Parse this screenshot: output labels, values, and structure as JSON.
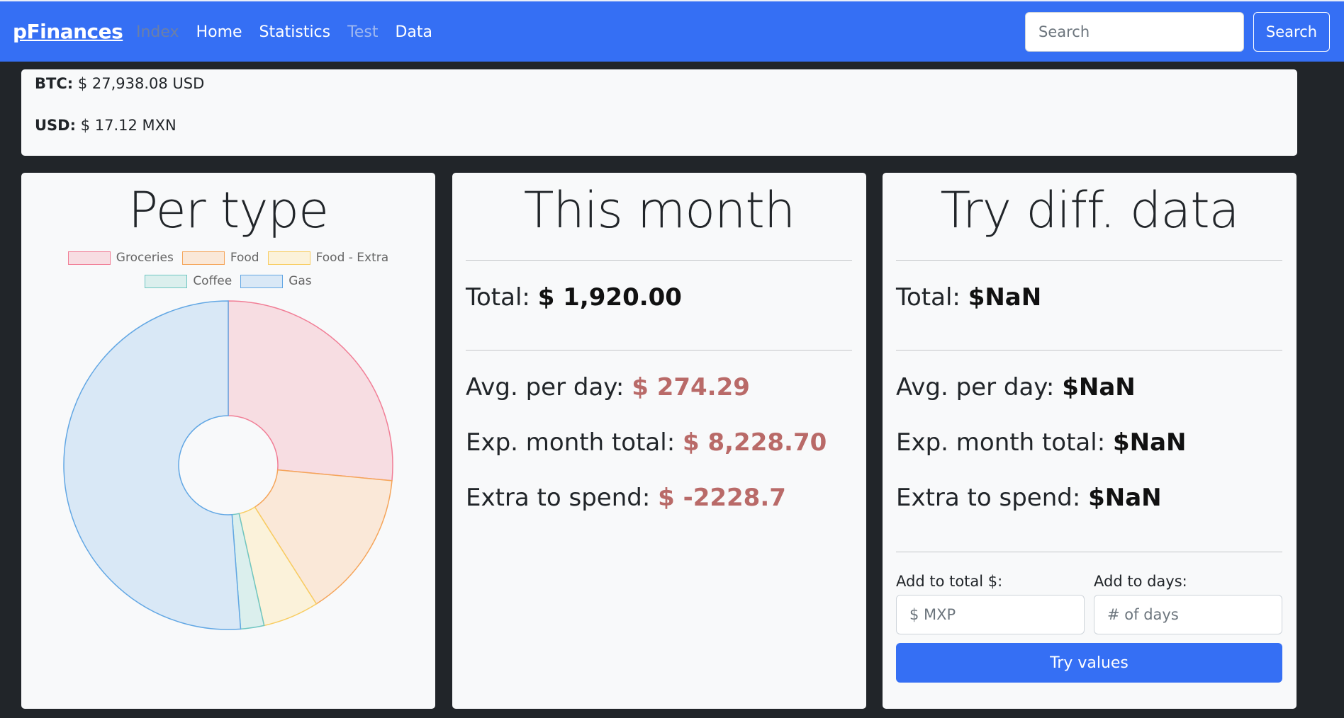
{
  "nav": {
    "brand": "pFinances",
    "links": [
      "Index",
      "Home",
      "Statistics",
      "Test",
      "Data"
    ],
    "search_placeholder": "Search",
    "search_button": "Search"
  },
  "prices": {
    "btc_label": "BTC:",
    "btc_value": "$ 27,938.08 USD",
    "usd_label": "USD:",
    "usd_value": "$ 17.12 MXN"
  },
  "per_type": {
    "title": "Per type"
  },
  "chart_data": {
    "type": "pie",
    "variant": "doughnut",
    "title": "",
    "legend_position": "top",
    "categories": [
      "Groceries",
      "Food",
      "Food - Extra",
      "Coffee",
      "Gas"
    ],
    "values": [
      26.5,
      14.5,
      5.5,
      2.3,
      51.2
    ],
    "colors": {
      "Groceries": {
        "fill": "#f7dde2",
        "border": "#f17e96"
      },
      "Food": {
        "fill": "#fae8d8",
        "border": "#f5a55a"
      },
      "Food - Extra": {
        "fill": "#fbf2da",
        "border": "#f8cd62"
      },
      "Coffee": {
        "fill": "#dbefed",
        "border": "#6fc6c2"
      },
      "Gas": {
        "fill": "#d9e8f6",
        "border": "#62a7e4"
      }
    }
  },
  "this_month": {
    "title": "This month",
    "total_label": "Total:",
    "total_value": "$ 1,920.00",
    "avg_label": "Avg. per day:",
    "avg_value": "$ 274.29",
    "exp_label": "Exp. month total:",
    "exp_value": "$ 8,228.70",
    "extra_label": "Extra to spend:",
    "extra_value": "$ -2228.7"
  },
  "try_data": {
    "title": "Try diff. data",
    "total_label": "Total:",
    "total_value": "$NaN",
    "avg_label": "Avg. per day:",
    "avg_value": "$NaN",
    "exp_label": "Exp. month total:",
    "exp_value": "$NaN",
    "extra_label": "Extra to spend:",
    "extra_value": "$NaN",
    "add_total_label": "Add to total $:",
    "add_total_placeholder": "$ MXP",
    "add_days_label": "Add to days:",
    "add_days_placeholder": "# of days",
    "try_button": "Try values"
  }
}
